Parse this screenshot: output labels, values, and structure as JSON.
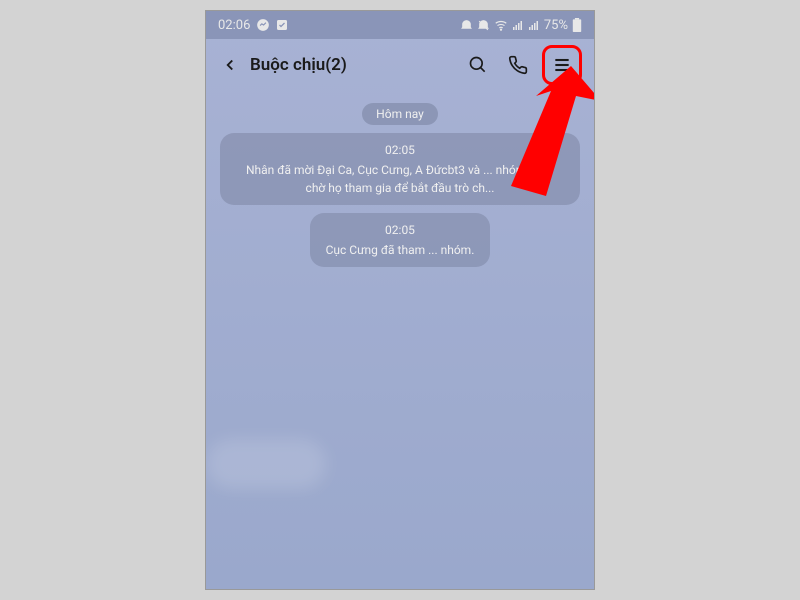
{
  "statusBar": {
    "time": "02:06",
    "battery": "75%"
  },
  "navBar": {
    "title": "Buộc chịu(2)"
  },
  "chat": {
    "dateBadge": "Hôm nay",
    "messages": [
      {
        "time": "02:05",
        "text": "Nhân đã mời Đại Ca, Cục Cưng, A Đứcbt3 và ... nhóm. ...ãy chờ họ tham gia để bắt đầu trò ch..."
      },
      {
        "time": "02:05",
        "text": "Cục Cưng đã tham ... nhóm."
      }
    ]
  }
}
